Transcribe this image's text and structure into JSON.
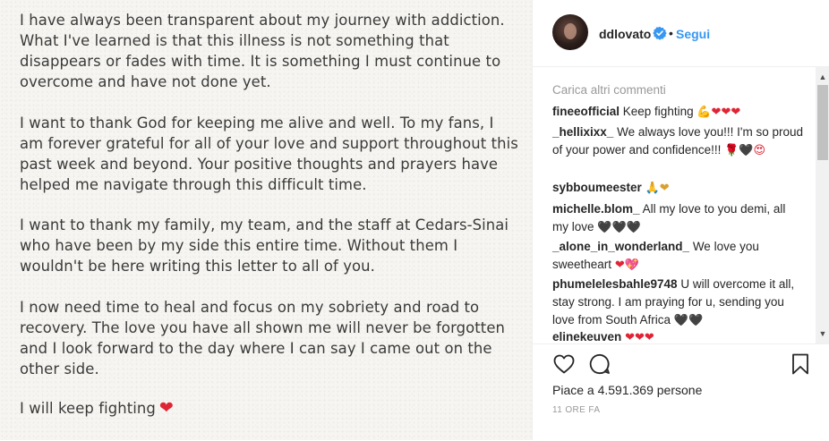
{
  "note": {
    "paragraphs": [
      "I have always been transparent about my journey with addiction.\nWhat I've learned is that this illness is not something that\ndisappears or fades with time.  It is something I must continue to\novercome and have not done yet.",
      "I want to thank God for keeping me alive and well. To my fans, I\nam forever grateful for all of your love and support throughout this\npast week and beyond. Your positive thoughts and prayers have\nhelped me navigate through this difficult time.",
      "I want to thank my family, my team, and the staff at Cedars-Sinai\nwho have been by my side this entire time. Without them I\nwouldn't be here writing this letter to all of you.",
      "I now need time to heal and focus on my sobriety and road to\nrecovery. The love you have all shown me will never be forgotten\nand I look forward to the day where I can say I came out on the\nother side."
    ],
    "closing": "I will keep fighting",
    "closing_emoji": "❤"
  },
  "header": {
    "username": "ddlovato",
    "separator": "•",
    "follow_label": "Segui"
  },
  "comments": {
    "load_more": "Carica altri commenti",
    "items": [
      {
        "user": "fineeofficial",
        "text": "Keep fighting",
        "emoji": "💪❤❤❤"
      },
      {
        "user": "_hellixixx_",
        "text": "We always love you!!! I'm so proud of your power and confidence!!!",
        "emoji": "🌹🖤😍"
      },
      {
        "user": "sybboumeester",
        "text": "",
        "emoji": "🙏❤"
      },
      {
        "user": "michelle.blom_",
        "text": "All my love to you demi, all my love",
        "emoji": "🖤🖤🖤"
      },
      {
        "user": "_alone_in_wonderland_",
        "text": "We love you sweetheart",
        "emoji": "❤💖"
      },
      {
        "user": "phumelelesbahle9748",
        "text": "U will overcome it all, stay strong. I am praying for u, sending you love from South Africa",
        "emoji": "🖤🖤"
      },
      {
        "user": "elinekeuven",
        "text": "",
        "emoji": "❤❤❤"
      }
    ]
  },
  "actions": {
    "likes": "Piace a 4.591.369 persone",
    "time": "11 ORE FA"
  },
  "icons": {
    "like": "heart-outline-icon",
    "comment": "comment-bubble-icon",
    "save": "bookmark-icon",
    "verified": "verified-badge-icon"
  },
  "colors": {
    "link_blue": "#3897f0",
    "heart_red": "#e02434",
    "muted": "#999999"
  }
}
